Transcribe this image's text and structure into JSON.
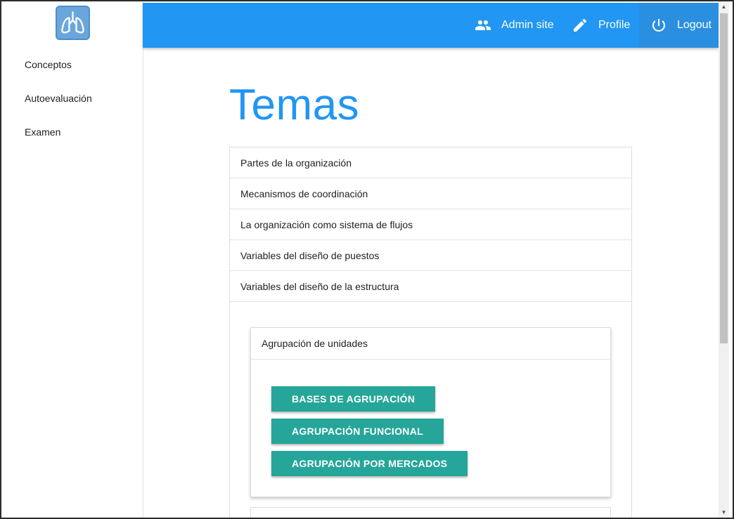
{
  "sidebar": {
    "logo": "lungs-logo-icon",
    "items": [
      {
        "label": "Conceptos"
      },
      {
        "label": "Autoevaluación"
      },
      {
        "label": "Examen"
      }
    ]
  },
  "header": {
    "bg_color": "#2196f3",
    "admin": {
      "label": "Admin site",
      "icon": "people-icon"
    },
    "profile": {
      "label": "Profile",
      "icon": "pencil-icon"
    },
    "logout": {
      "label": "Logout",
      "icon": "power-icon"
    }
  },
  "main": {
    "title": "Temas",
    "topics": [
      {
        "label": "Partes de la organización"
      },
      {
        "label": "Mecanismos de coordinación"
      },
      {
        "label": "La organización como sistema de flujos"
      },
      {
        "label": "Variables del diseño de puestos"
      },
      {
        "label": "Variables del diseño de la estructura"
      }
    ],
    "subsection": {
      "title": "Agrupación de unidades",
      "buttons": [
        {
          "label": "BASES DE AGRUPACIÓN"
        },
        {
          "label": "AGRUPACIÓN FUNCIONAL"
        },
        {
          "label": "AGRUPACIÓN POR MERCADOS"
        }
      ],
      "button_color": "#26a69a"
    }
  }
}
